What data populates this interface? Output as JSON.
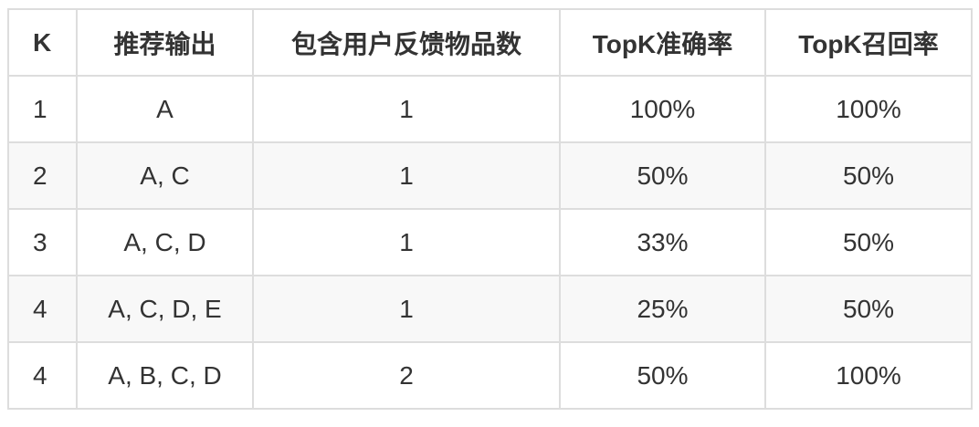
{
  "table": {
    "headers": [
      "K",
      "推荐输出",
      "包含用户反馈物品数",
      "TopK准确率",
      "TopK召回率"
    ],
    "rows": [
      [
        "1",
        "A",
        "1",
        "100%",
        "100%"
      ],
      [
        "2",
        "A, C",
        "1",
        "50%",
        "50%"
      ],
      [
        "3",
        "A, C, D",
        "1",
        "33%",
        "50%"
      ],
      [
        "4",
        "A, C, D, E",
        "1",
        "25%",
        "50%"
      ],
      [
        "4",
        "A, B, C, D",
        "2",
        "50%",
        "100%"
      ]
    ]
  },
  "colors": {
    "border": "#dddddd",
    "stripe": "#f8f8f8",
    "text": "#333333"
  }
}
